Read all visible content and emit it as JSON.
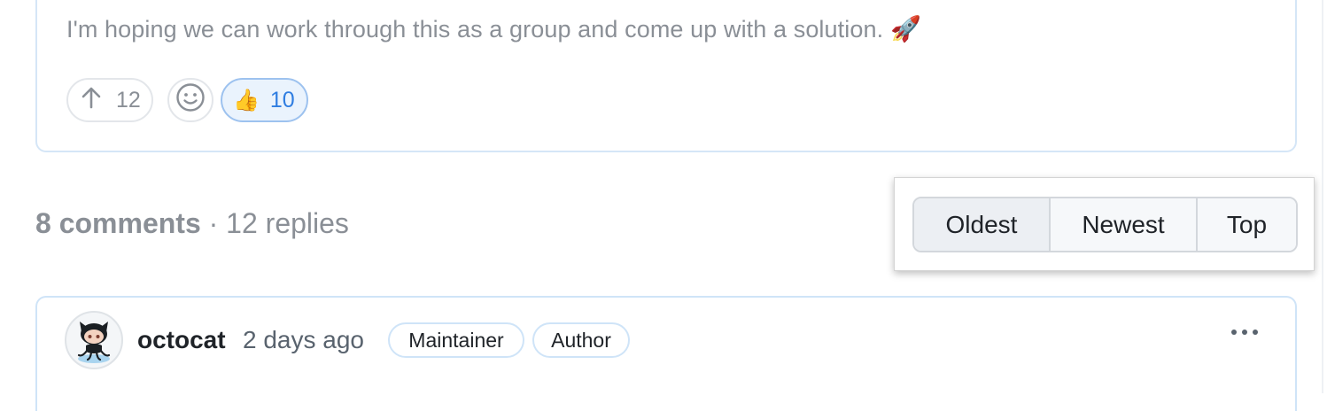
{
  "post": {
    "body_text": "I'm hoping we can work through this as a group and come up with a solution.",
    "body_emoji": "🚀",
    "upvote_count": "12",
    "thumbs_emoji": "👍",
    "thumbs_count": "10",
    "icons": {
      "upvote": "arrow-up-icon",
      "add_reaction": "smiley-icon",
      "reaction": "thumbs-up-icon"
    }
  },
  "comments_summary": {
    "comments": "8 comments",
    "separator": " · ",
    "replies": "12 replies"
  },
  "sort": {
    "options": [
      "Oldest",
      "Newest",
      "Top"
    ],
    "selected": "Oldest"
  },
  "comment": {
    "author": "octocat",
    "time": "2 days ago",
    "badges": [
      "Maintainer",
      "Author"
    ],
    "icons": {
      "avatar": "octocat-avatar",
      "menu": "kebab-menu-icon"
    }
  },
  "colors": {
    "accent_blue": "#2f7de1",
    "card_border": "#d5e6f7",
    "muted_text": "#8a8f96"
  }
}
